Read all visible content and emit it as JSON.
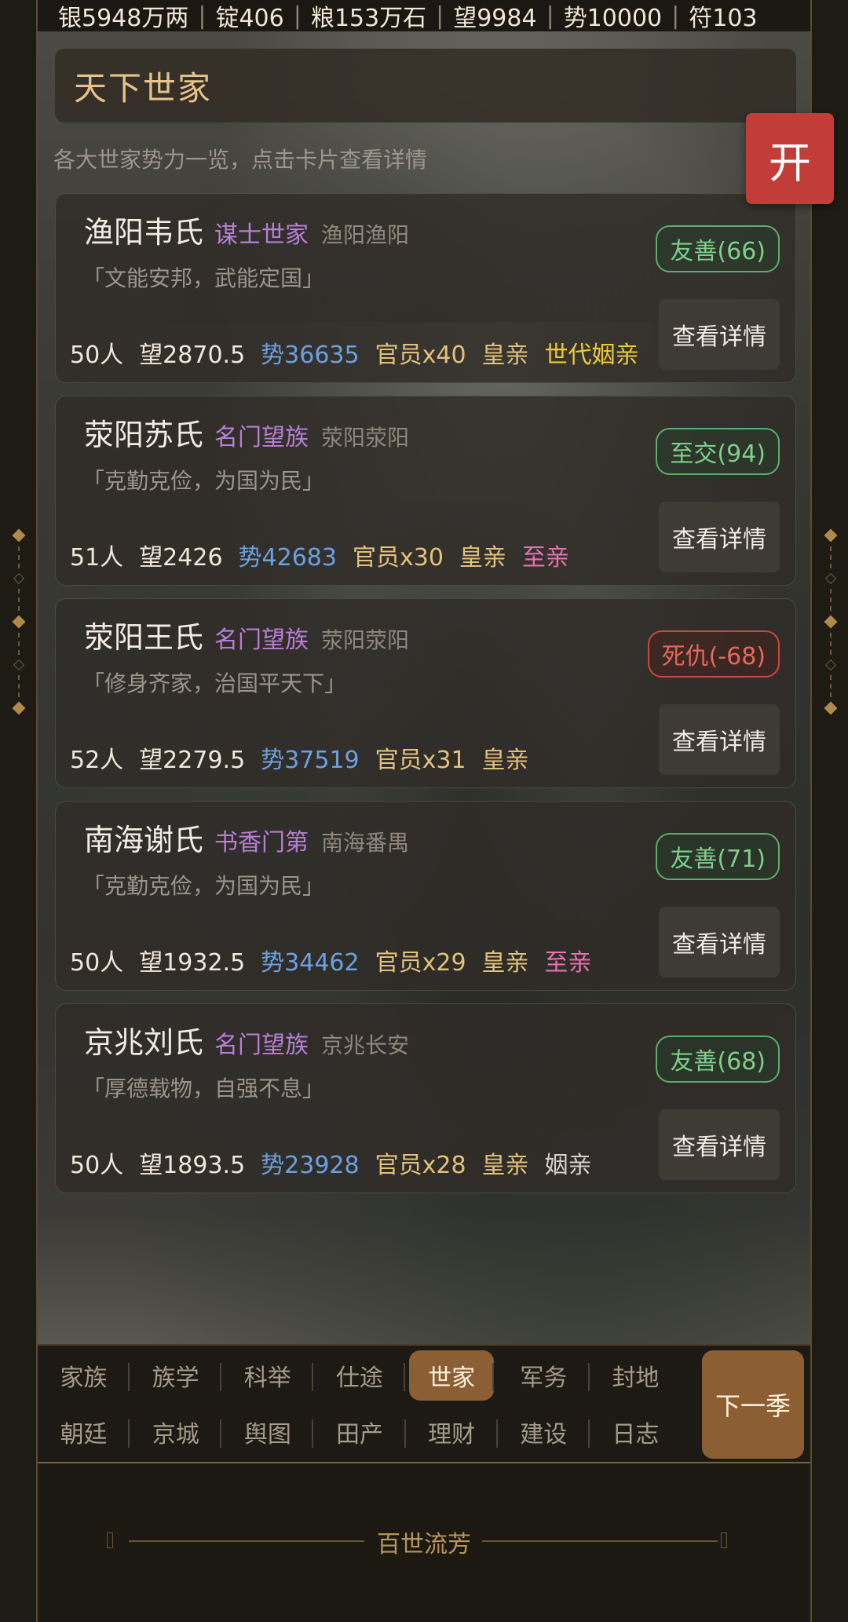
{
  "resources": [
    "银5948万两",
    "锭406",
    "粮153万石",
    "望9984",
    "势10000",
    "符103"
  ],
  "header": {
    "title": "天下世家",
    "subtitle": "各大世家势力一览，点击卡片查看详情",
    "open_button": "开"
  },
  "detail_label": "查看详情",
  "families": [
    {
      "name": "渔阳韦氏",
      "type": "谋士世家",
      "place": "渔阳渔阳",
      "motto": "「文能安邦，武能定国」",
      "relation": "友善(66)",
      "relation_kind": "good",
      "people": "50人",
      "prestige": "望2870.5",
      "power": "势36635",
      "officials": "官员x40",
      "royal": "皇亲",
      "extra": "世代姻亲",
      "extra_color": "#f0c93a"
    },
    {
      "name": "荥阳苏氏",
      "type": "名门望族",
      "place": "荥阳荥阳",
      "motto": "「克勤克俭，为国为民」",
      "relation": "至交(94)",
      "relation_kind": "good",
      "people": "51人",
      "prestige": "望2426",
      "power": "势42683",
      "officials": "官员x30",
      "royal": "皇亲",
      "extra": "至亲",
      "extra_color": "#e870b0"
    },
    {
      "name": "荥阳王氏",
      "type": "名门望族",
      "place": "荥阳荥阳",
      "motto": "「修身齐家，治国平天下」",
      "relation": "死仇(-68)",
      "relation_kind": "bad",
      "people": "52人",
      "prestige": "望2279.5",
      "power": "势37519",
      "officials": "官员x31",
      "royal": "皇亲",
      "extra": "",
      "extra_color": ""
    },
    {
      "name": "南海谢氏",
      "type": "书香门第",
      "place": "南海番禺",
      "motto": "「克勤克俭，为国为民」",
      "relation": "友善(71)",
      "relation_kind": "good",
      "people": "50人",
      "prestige": "望1932.5",
      "power": "势34462",
      "officials": "官员x29",
      "royal": "皇亲",
      "extra": "至亲",
      "extra_color": "#e870b0"
    },
    {
      "name": "京兆刘氏",
      "type": "名门望族",
      "place": "京兆长安",
      "motto": "「厚德载物，自强不息」",
      "relation": "友善(68)",
      "relation_kind": "good",
      "people": "50人",
      "prestige": "望1893.5",
      "power": "势23928",
      "officials": "官员x28",
      "royal": "皇亲",
      "extra": "姻亲",
      "extra_color": "#d8d3c8"
    }
  ],
  "nav": {
    "row1": [
      "家族",
      "族学",
      "科举",
      "仕途",
      "世家",
      "军务",
      "封地"
    ],
    "row2": [
      "朝廷",
      "京城",
      "舆图",
      "田产",
      "理财",
      "建设",
      "日志"
    ],
    "active": "世家",
    "next_button": "下一季"
  },
  "footer": {
    "text": "百世流芳"
  }
}
